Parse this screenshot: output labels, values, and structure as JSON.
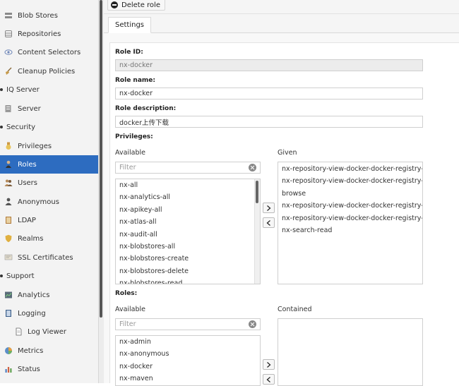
{
  "sidebar": {
    "items": [
      {
        "label": "Blob Stores",
        "icon": "server-icon",
        "active": false
      },
      {
        "label": "Repositories",
        "icon": "database-icon",
        "active": false
      },
      {
        "label": "Content Selectors",
        "icon": "eye-icon",
        "active": false
      },
      {
        "label": "Cleanup Policies",
        "icon": "broom-icon",
        "active": false
      },
      {
        "label": "IQ Server",
        "icon": "",
        "active": false
      },
      {
        "label": "Server",
        "icon": "server-small-icon",
        "active": false
      },
      {
        "label": "Security",
        "icon": "",
        "active": false
      },
      {
        "label": "Privileges",
        "icon": "medal-icon",
        "active": false
      },
      {
        "label": "Roles",
        "icon": "user-tie-icon",
        "active": true
      },
      {
        "label": "Users",
        "icon": "users-icon",
        "active": false
      },
      {
        "label": "Anonymous",
        "icon": "user-silhouette-icon",
        "active": false
      },
      {
        "label": "LDAP",
        "icon": "book-icon",
        "active": false
      },
      {
        "label": "Realms",
        "icon": "shield-icon",
        "active": false
      },
      {
        "label": "SSL Certificates",
        "icon": "certificate-icon",
        "active": false
      },
      {
        "label": "Support",
        "icon": "",
        "active": false
      },
      {
        "label": "Analytics",
        "icon": "chart-icon",
        "active": false
      },
      {
        "label": "Logging",
        "icon": "log-book-icon",
        "active": false
      },
      {
        "label": "Log Viewer",
        "icon": "document-icon",
        "active": false
      },
      {
        "label": "Metrics",
        "icon": "pie-icon",
        "active": false
      },
      {
        "label": "Status",
        "icon": "bar-chart-icon",
        "active": false
      }
    ]
  },
  "toolbar": {
    "delete_label": "Delete role"
  },
  "tabs": [
    {
      "label": "Settings"
    }
  ],
  "form": {
    "role_id_label": "Role ID:",
    "role_id_value": "nx-docker",
    "role_name_label": "Role name:",
    "role_name_value": "nx-docker",
    "role_description_label": "Role description:",
    "role_description_value": "docker上传下载",
    "privileges_label": "Privileges:",
    "roles_label": "Roles:"
  },
  "privileges": {
    "available_label": "Available",
    "given_label": "Given",
    "filter_placeholder": "Filter",
    "available": [
      "nx-all",
      "nx-analytics-all",
      "nx-apikey-all",
      "nx-atlas-all",
      "nx-audit-all",
      "nx-blobstores-all",
      "nx-blobstores-create",
      "nx-blobstores-delete",
      "nx-blobstores-read"
    ],
    "given": [
      "nx-repository-view-docker-docker-registry-add",
      "nx-repository-view-docker-docker-registry-",
      "browse",
      "nx-repository-view-docker-docker-registry-edit",
      "nx-repository-view-docker-docker-registry-read",
      "nx-search-read"
    ]
  },
  "roles": {
    "available_label": "Available",
    "contained_label": "Contained",
    "filter_placeholder": "Filter",
    "available": [
      "nx-admin",
      "nx-anonymous",
      "nx-docker",
      "nx-maven"
    ],
    "contained": []
  },
  "colors": {
    "accent": "#2d6cc0"
  }
}
